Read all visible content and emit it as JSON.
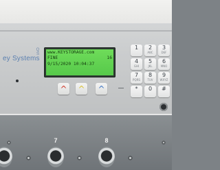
{
  "device": {
    "brand_text": "ey Systems",
    "brand_mark_text": "Q\nS"
  },
  "lcd": {
    "line1": "www.KEYSTORAGE.com",
    "line2_left": "FINE",
    "line2_right": "16",
    "line3": "9/15/2020 10:04:37",
    "background_color": "#62d250",
    "text_color": "#133a0f"
  },
  "arrow_keys": [
    {
      "glyph": "^",
      "color": "#d13a2c",
      "icon": "arrow-up-red-icon"
    },
    {
      "glyph": "^",
      "color": "#d9c235",
      "icon": "arrow-up-yellow-icon"
    },
    {
      "glyph": "^",
      "color": "#3f77c4",
      "icon": "arrow-up-blue-icon"
    }
  ],
  "keypad": {
    "keys": [
      {
        "label": "1",
        "sub": ""
      },
      {
        "label": "2",
        "sub": "ABC"
      },
      {
        "label": "3",
        "sub": "DEF"
      },
      {
        "label": "4",
        "sub": "GHI"
      },
      {
        "label": "5",
        "sub": "JKL"
      },
      {
        "label": "6",
        "sub": "MNO"
      },
      {
        "label": "7",
        "sub": "PQRS"
      },
      {
        "label": "8",
        "sub": "TUV"
      },
      {
        "label": "9",
        "sub": "WXYZ"
      },
      {
        "label": "*",
        "sub": ""
      },
      {
        "label": "0",
        "sub": ""
      },
      {
        "label": "#",
        "sub": ""
      }
    ]
  },
  "ports": [
    {
      "label": ""
    },
    {
      "label": "7"
    },
    {
      "label": "8"
    }
  ]
}
